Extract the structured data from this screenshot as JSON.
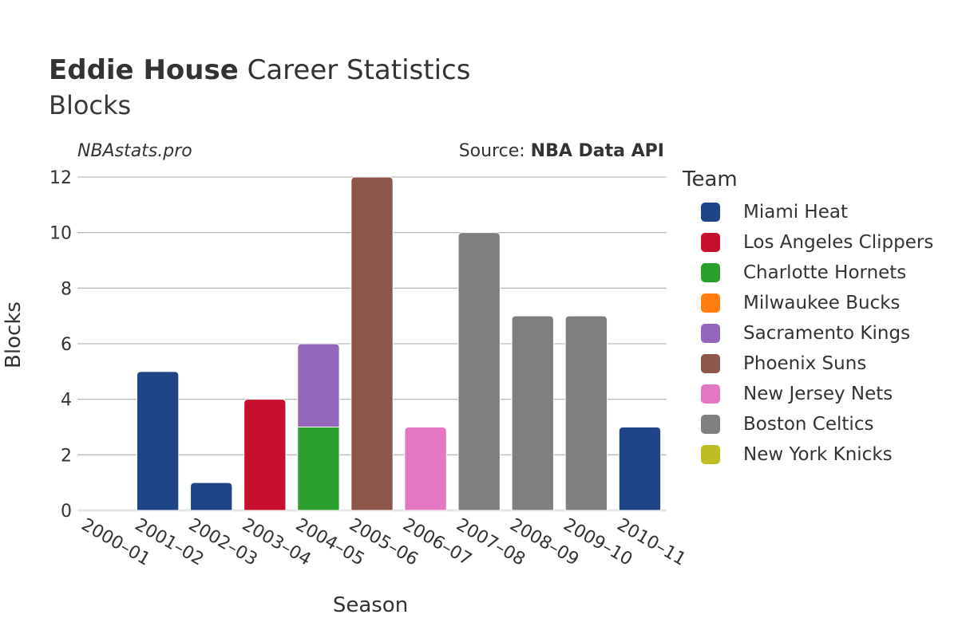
{
  "header": {
    "title_bold": "Eddie House",
    "title_rest": " Career Statistics",
    "subtitle": "Blocks",
    "site": "NBAstats.pro",
    "source_prefix": "Source: ",
    "source_name": "NBA Data API"
  },
  "legend": {
    "title": "Team",
    "items": [
      {
        "label": "Miami Heat",
        "color": "#1f4488"
      },
      {
        "label": "Los Angeles Clippers",
        "color": "#c8102e"
      },
      {
        "label": "Charlotte Hornets",
        "color": "#2ca02c"
      },
      {
        "label": "Milwaukee Bucks",
        "color": "#ff7f0e"
      },
      {
        "label": "Sacramento Kings",
        "color": "#9467bd"
      },
      {
        "label": "Phoenix Suns",
        "color": "#8c564b"
      },
      {
        "label": "New Jersey Nets",
        "color": "#e377c2"
      },
      {
        "label": "Boston Celtics",
        "color": "#7f7f7f"
      },
      {
        "label": "New York Knicks",
        "color": "#bcbd22"
      }
    ]
  },
  "chart_data": {
    "type": "bar",
    "stacked": true,
    "title": "Eddie House Career Statistics",
    "subtitle": "Blocks",
    "xlabel": "Season",
    "ylabel": "Blocks",
    "ylim": [
      0,
      12
    ],
    "yticks": [
      0,
      2,
      4,
      6,
      8,
      10,
      12
    ],
    "grid": true,
    "legend_position": "right",
    "categories": [
      "2000–01",
      "2001–02",
      "2002–03",
      "2003–04",
      "2004–05",
      "2005–06",
      "2006–07",
      "2007–08",
      "2008–09",
      "2009–10",
      "2010–11"
    ],
    "series": [
      {
        "name": "Miami Heat",
        "color": "#1f4488",
        "values": [
          0,
          5,
          1,
          0,
          0,
          0,
          0,
          0,
          0,
          0,
          3
        ]
      },
      {
        "name": "Los Angeles Clippers",
        "color": "#c8102e",
        "values": [
          0,
          0,
          0,
          4,
          0,
          0,
          0,
          0,
          0,
          0,
          0
        ]
      },
      {
        "name": "Charlotte Hornets",
        "color": "#2ca02c",
        "values": [
          0,
          0,
          0,
          0,
          3,
          0,
          0,
          0,
          0,
          0,
          0
        ]
      },
      {
        "name": "Milwaukee Bucks",
        "color": "#ff7f0e",
        "values": [
          0,
          0,
          0,
          0,
          0,
          0,
          0,
          0,
          0,
          0,
          0
        ]
      },
      {
        "name": "Sacramento Kings",
        "color": "#9467bd",
        "values": [
          0,
          0,
          0,
          0,
          3,
          0,
          0,
          0,
          0,
          0,
          0
        ]
      },
      {
        "name": "Phoenix Suns",
        "color": "#8c564b",
        "values": [
          0,
          0,
          0,
          0,
          0,
          12,
          0,
          0,
          0,
          0,
          0
        ]
      },
      {
        "name": "New Jersey Nets",
        "color": "#e377c2",
        "values": [
          0,
          0,
          0,
          0,
          0,
          0,
          3,
          0,
          0,
          0,
          0
        ]
      },
      {
        "name": "Boston Celtics",
        "color": "#7f7f7f",
        "values": [
          0,
          0,
          0,
          0,
          0,
          0,
          0,
          10,
          7,
          7,
          0
        ]
      },
      {
        "name": "New York Knicks",
        "color": "#bcbd22",
        "values": [
          0,
          0,
          0,
          0,
          0,
          0,
          0,
          0,
          0,
          0,
          0
        ]
      }
    ]
  }
}
